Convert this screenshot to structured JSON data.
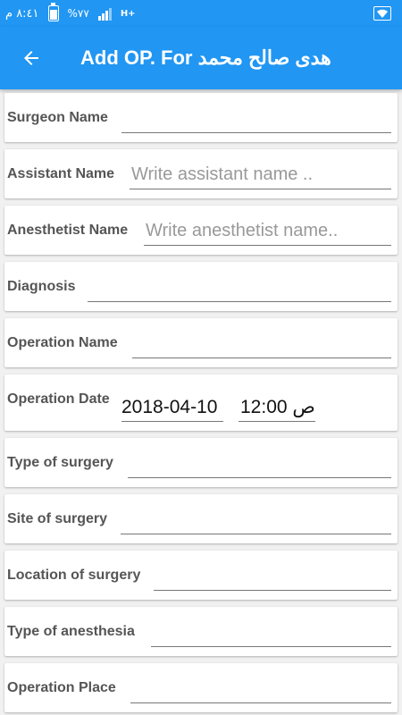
{
  "status_bar": {
    "time": "٨:٤١ م",
    "battery": "%٧٧",
    "network": "H+"
  },
  "app_bar": {
    "title": "Add OP. For هدى صالح محمد"
  },
  "form": {
    "fields": [
      {
        "label": "Surgeon Name",
        "value": "",
        "placeholder": ""
      },
      {
        "label": "Assistant Name",
        "value": "",
        "placeholder": "Write assistant name .."
      },
      {
        "label": "Anesthetist Name",
        "value": "",
        "placeholder": "Write anesthetist name.."
      },
      {
        "label": "Diagnosis",
        "value": "",
        "placeholder": ""
      },
      {
        "label": "Operation Name",
        "value": "",
        "placeholder": ""
      },
      {
        "label": "Operation Date",
        "date": "2018-04-10",
        "time": "12:00 ص"
      },
      {
        "label": "Type of surgery",
        "value": "",
        "placeholder": ""
      },
      {
        "label": "Site of surgery",
        "value": "",
        "placeholder": ""
      },
      {
        "label": "Location of surgery",
        "value": "",
        "placeholder": ""
      },
      {
        "label": "Type of anesthesia",
        "value": "",
        "placeholder": ""
      },
      {
        "label": "Operation Place",
        "value": "",
        "placeholder": ""
      }
    ]
  }
}
